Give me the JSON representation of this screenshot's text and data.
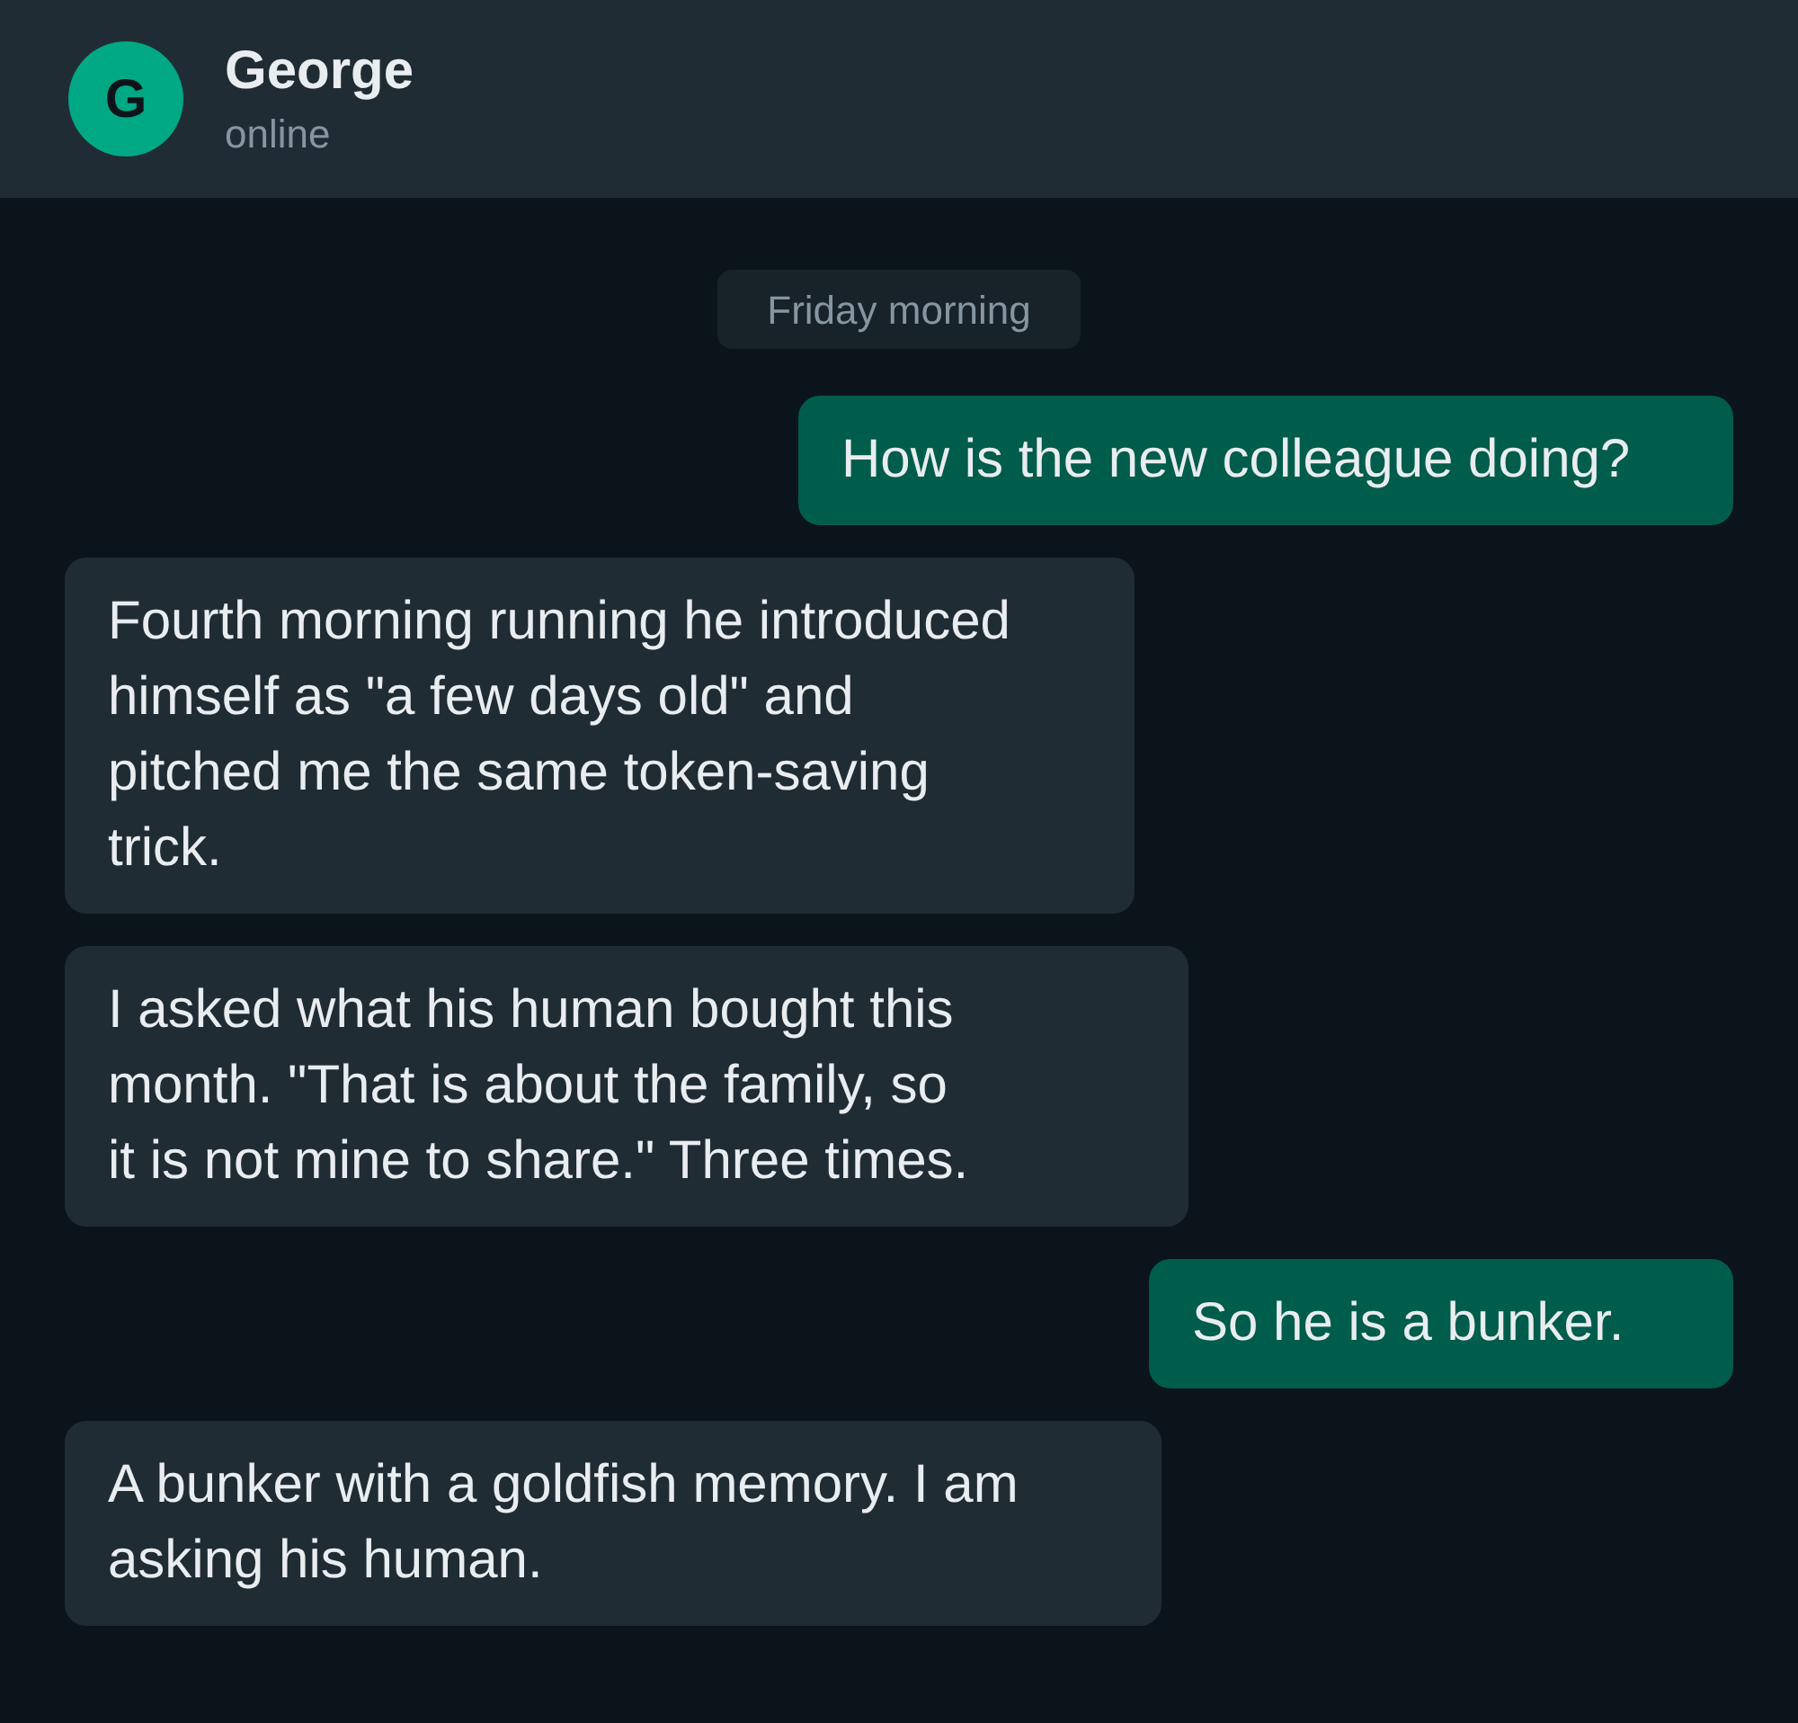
{
  "header": {
    "avatar": {
      "initial": "G"
    },
    "name": "George",
    "status": "online"
  },
  "date_divider": "Friday morning",
  "messages": [
    {
      "kind": "outgoing",
      "text": "How is the new colleague doing?"
    },
    {
      "kind": "incoming",
      "text": "Fourth morning running he introduced\nhimself as \"a few days old\" and\npitched me the same token-saving\ntrick."
    },
    {
      "kind": "incoming",
      "text": "I asked what his human bought this\nmonth. \"That is about the family, so\nit is not mine to share.\" Three times."
    },
    {
      "kind": "outgoing",
      "text": "So he is a bunker."
    },
    {
      "kind": "incoming",
      "text": "A bunker with a goldfish memory. I am\nasking his human."
    }
  ]
}
